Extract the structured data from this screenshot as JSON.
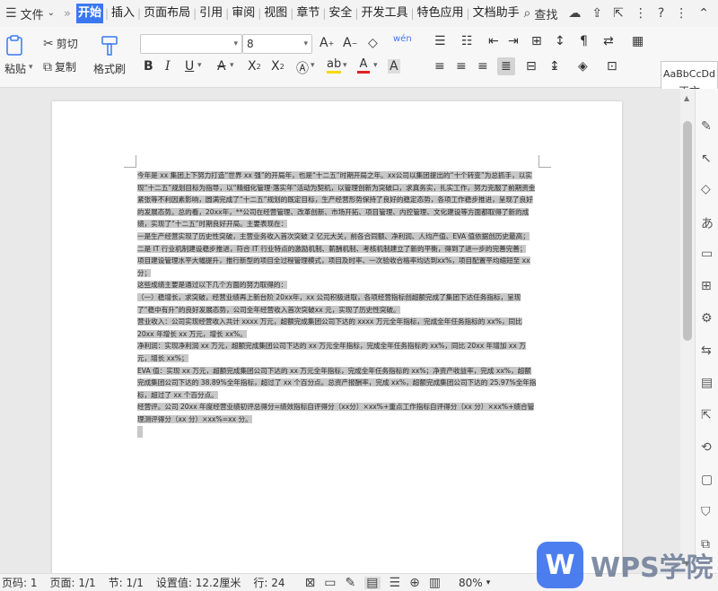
{
  "menubar": {
    "file_label": "文件",
    "tabs": [
      "开始",
      "插入",
      "页面布局",
      "引用",
      "审阅",
      "视图",
      "章节",
      "安全",
      "开发工具",
      "特色应用",
      "文档助手"
    ],
    "active_tab": "开始",
    "search_label": "查找"
  },
  "ribbon": {
    "paste_label": "粘贴",
    "cut_label": "剪切",
    "copy_label": "复制",
    "format_painter_label": "格式刷",
    "font_name_value": "",
    "font_size_value": "8",
    "style_sample": "AaBbCcDd",
    "style_name": "正文",
    "colors": {
      "highlight": "#f5d90a",
      "font_color": "#e02020",
      "accent": "#3a78f2"
    }
  },
  "document": {
    "paragraphs": [
      "今年是 xx 集团上下努力打造“世界 xx 强”的开局年，也是“十二五”时期开局之年。xx公司以集团提出的“十个转变”为总抓手，以实现“十二五”规划目标为指导，以“精细化管理·落实年”活动为契机，以管理创新为突破口，求真务实，扎实工作，努力克服了前期资金紧张等不利因素影响，圆满完成了“十二五”规划的既定目标，生产经营形势保持了良好的稳定态势，各项工作稳步推进，呈现了良好的发展态势。总的看，20xx年，**公司在经营管理、改革创新、市场开拓、项目管理、内控管理、文化建设等方面都取得了新的成绩，实现了“十二五”时期良好开局。主要表现在：",
      "一是生产经营实现了历史性突破，主营业务收入首次突破 2 亿元大关，前各合同额、净利润、人均产值、EVA 值依据创历史最高；",
      "二是 IT 行业机制建设稳步推进，符合 IT 行业特点的激励机制、薪酬机制、考核机制建立了新的平衡，得到了进一步的完善完善；",
      "项目建设管理水平大幅提升，推行新型的项目全过程管理模式，项目及时率、一次验收合格率均达到xx%，项目配置平均缩短至 xx 分；",
      "这些成绩主要是通过以下几个方面的努力取得的：",
      "（一）稳增长，求突破，经营业绩再上新台阶 20xx年，xx 公司积极进取，各项经营指标创超额完成了集团下达任务指标，呈现了“稳中有升”的良好发展态势，公司全年经营收入首次突破xx 元，实现了历史性突破。",
      "营业收入：公司实现经营收入共计 xxxx 万元，超额完成集团公司下达的 xxxx 万元全年指标，完成全年任务指标的 xx%，同比20xx 年增长 xx 万元，增长 xx%。",
      "净利润：实现净利润 xx 万元，超额完成集团公司下达的 xx 万元全年指标，完成全年任务指标的 xx%，同比 20xx 年增加 xx 万元，增长 xx%；",
      "EVA 值：实现 xx 万元，超额完成集团公司下达的 xx 万元全年指标，完成全年任务指标的 xx%；净资产收益率，完成 xx%，超额完成集团公司下达的 38.89%全年指标，超过了 xx 个百分点。总资产报酬率，完成 xx%，超额完成集团公司下达的 25.97%全年指标，超过了 xx 个百分点。",
      "经营评。公司 20xx 年度经营业绩初评总得分=绩效指标自评得分（xx分）×xx%+重点工作指标自评得分（xx 分）×xx%+绩合管理测评得分（xx 分）×xx%=xx 分。"
    ]
  },
  "statusbar": {
    "page_label": "页码: 1",
    "pages_label": "页面: 1/1",
    "section_label": "节: 1/1",
    "setting_label": "设置值: 12.2厘米",
    "line_label": "行: 24",
    "zoom_label": "80%"
  },
  "watermark": {
    "logo_letter": "W",
    "text": "WPS学院"
  }
}
